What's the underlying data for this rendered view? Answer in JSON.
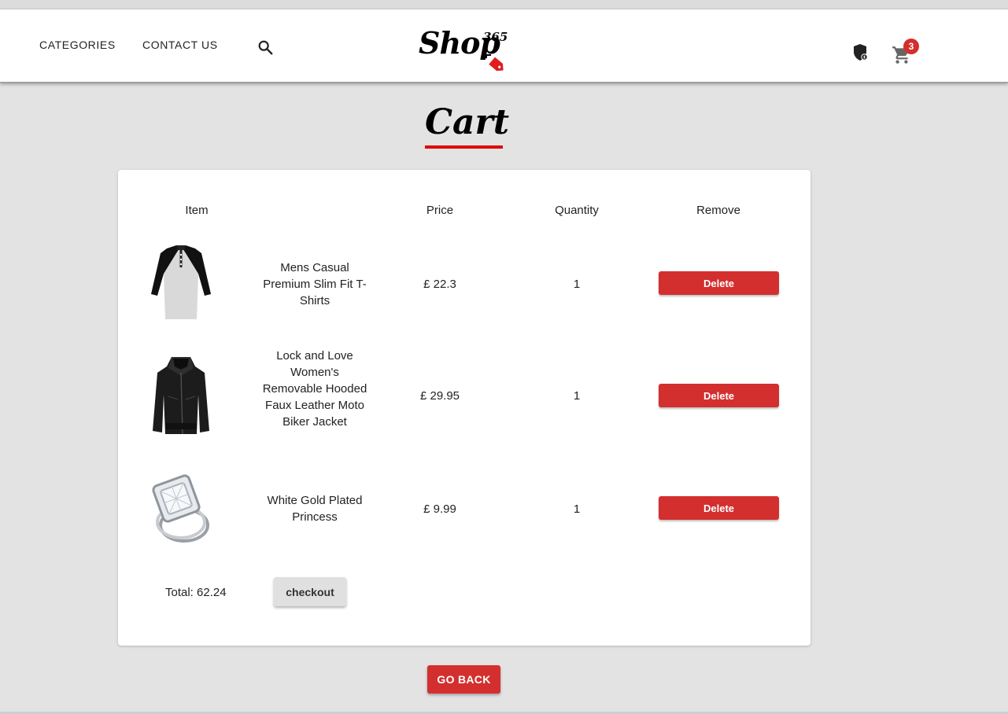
{
  "nav": {
    "categories_label": "CATEGORIES",
    "contact_label": "CONTACT US",
    "logo_text": "Shop",
    "logo_number": "365",
    "cart_count": "3"
  },
  "page": {
    "title": "Cart"
  },
  "table": {
    "headers": {
      "item": "Item",
      "price": "Price",
      "quantity": "Quantity",
      "remove": "Remove"
    },
    "rows": [
      {
        "name": "Mens Casual Premium Slim Fit T-Shirts",
        "price": "£ 22.3",
        "quantity": "1",
        "delete_label": "Delete",
        "image": "t-shirt-image"
      },
      {
        "name": "Lock and Love Women's Removable Hooded Faux Leather Moto Biker Jacket",
        "price": "£ 29.95",
        "quantity": "1",
        "delete_label": "Delete",
        "image": "jacket-image"
      },
      {
        "name": "White Gold Plated Princess",
        "price": "£ 9.99",
        "quantity": "1",
        "delete_label": "Delete",
        "image": "ring-image"
      }
    ]
  },
  "summary": {
    "total": "Total: 62.24",
    "checkout_label": "checkout"
  },
  "footer": {
    "go_back_label": "GO BACK"
  },
  "colors": {
    "accent": "#d32f2f",
    "background": "#e3e3e3",
    "title_underline": "#e00000"
  }
}
